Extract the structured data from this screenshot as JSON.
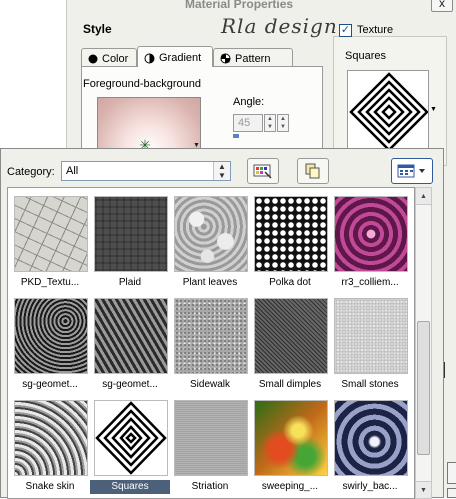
{
  "dialog": {
    "title": "Material Properties",
    "close_label": "x",
    "style_label": "Style",
    "signature_text": "Rla design",
    "tabs": [
      {
        "label": "Color",
        "icon": "color-dot-icon",
        "active": false
      },
      {
        "label": "Gradient",
        "icon": "gradient-icon",
        "active": true
      },
      {
        "label": "Pattern",
        "icon": "pattern-icon",
        "active": false
      }
    ],
    "gradient": {
      "name": "Foreground-background",
      "angle_label": "Angle:",
      "angle_value": "45"
    },
    "texture": {
      "checkbox_label": "Texture",
      "checked": true,
      "current_name": "Squares"
    }
  },
  "browser": {
    "category_label": "Category:",
    "category_value": "All",
    "toolbar_icons": [
      "browse-icon",
      "copy-icon",
      "view-options-icon"
    ],
    "textures": [
      {
        "name": "PKD_Textu...",
        "pattern": "cracked"
      },
      {
        "name": "Plaid",
        "pattern": "plaid"
      },
      {
        "name": "Plant leaves",
        "pattern": "leaves"
      },
      {
        "name": "Polka dot",
        "pattern": "polka"
      },
      {
        "name": "rr3_colliem...",
        "pattern": "swirl"
      },
      {
        "name": "sg-geomet...",
        "pattern": "geo1"
      },
      {
        "name": "sg-geomet...",
        "pattern": "geo2"
      },
      {
        "name": "Sidewalk",
        "pattern": "sidewalk"
      },
      {
        "name": "Small dimples",
        "pattern": "dimples"
      },
      {
        "name": "Small stones",
        "pattern": "stones"
      },
      {
        "name": "Snake skin",
        "pattern": "snake"
      },
      {
        "name": "Squares",
        "pattern": "squares",
        "selected": true
      },
      {
        "name": "Striation",
        "pattern": "striation"
      },
      {
        "name": "sweeping_...",
        "pattern": "sweep"
      },
      {
        "name": "swirly_bac...",
        "pattern": "swirly"
      }
    ]
  },
  "colors": {
    "selection": "#4d607a",
    "dialog_bg": "#f0f0ea"
  }
}
